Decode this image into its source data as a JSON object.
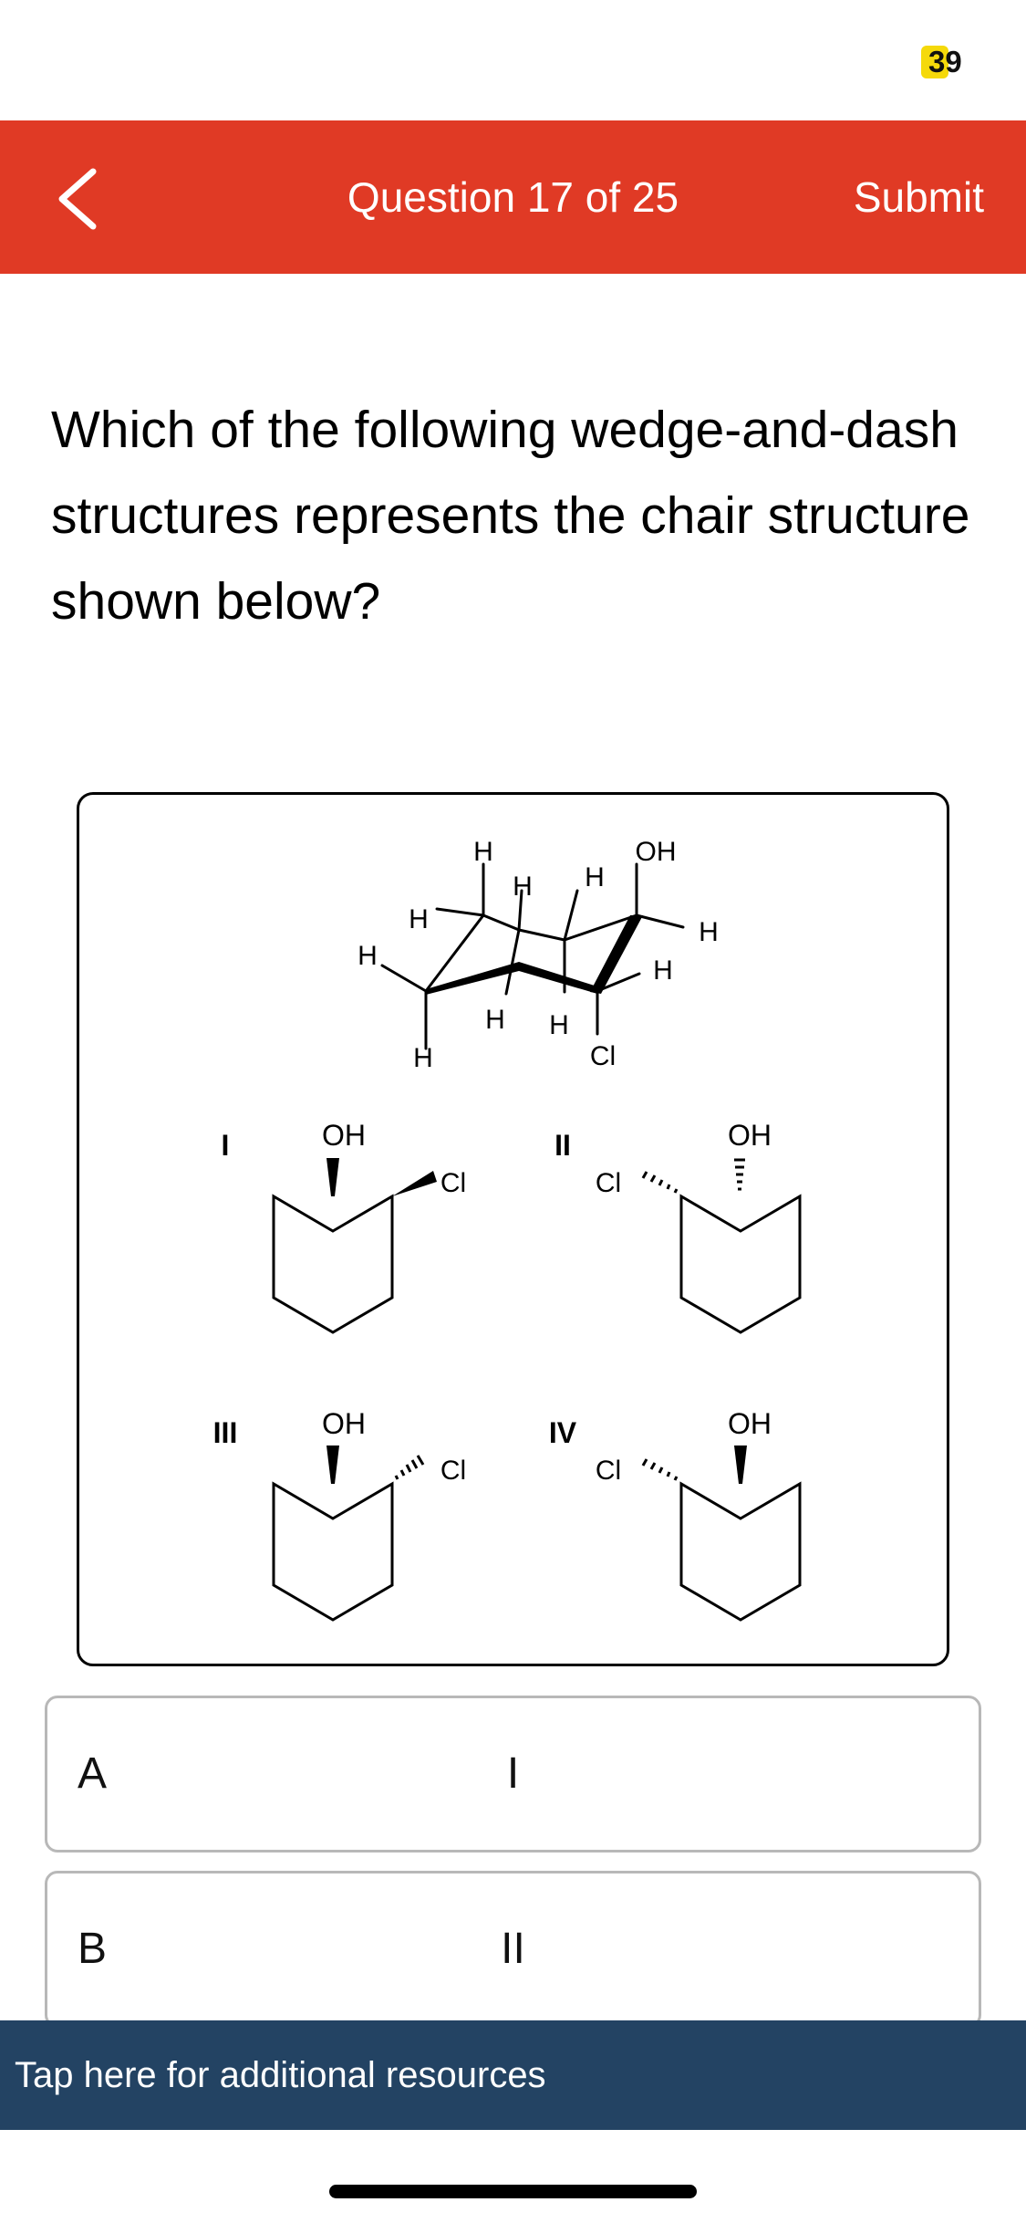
{
  "status_bar": {
    "timer": "39",
    "timer_color": "#f5d90a"
  },
  "header": {
    "title": "Question 17 of 25",
    "submit_label": "Submit",
    "back_icon": "chevron-left-icon",
    "background_color": "#e03a25"
  },
  "question": {
    "text": "Which of the following wedge-and-dash structures represents the chair structure shown below?"
  },
  "figure": {
    "chair": {
      "labels": [
        "H",
        "OH",
        "H",
        "H",
        "H",
        "H",
        "H",
        "H",
        "H",
        "H",
        "Cl"
      ]
    },
    "structures": [
      {
        "numeral": "I",
        "top_group": "OH",
        "side_group": "Cl"
      },
      {
        "numeral": "II",
        "top_group": "OH",
        "side_group": "Cl"
      },
      {
        "numeral": "III",
        "top_group": "OH",
        "side_group": "Cl"
      },
      {
        "numeral": "IV",
        "top_group": "OH",
        "side_group": "Cl"
      }
    ]
  },
  "options": [
    {
      "letter": "A",
      "value": "I"
    },
    {
      "letter": "B",
      "value": "II"
    }
  ],
  "resources_bar": {
    "label": "Tap here for additional resources",
    "background_color": "#234363"
  }
}
